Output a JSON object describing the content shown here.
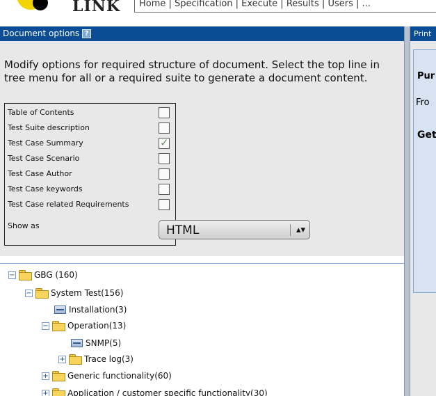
{
  "header": {
    "logo_text": "LINK",
    "nav_items": [
      "Home",
      "Specification",
      "Execute",
      "Results",
      "Users",
      "..."
    ]
  },
  "document_options": {
    "title": "Document options",
    "help_icon": "?",
    "instructions": "Modify options for required structure of document. Select the top line in tree menu for all or a required suite to generate a document content.",
    "options": [
      {
        "label": "Table of Contents",
        "checked": false
      },
      {
        "label": "Test Suite description",
        "checked": false
      },
      {
        "label": "Test Case Summary",
        "checked": true
      },
      {
        "label": "Test Case Scenario",
        "checked": false
      },
      {
        "label": "Test Case Author",
        "checked": false
      },
      {
        "label": "Test Case keywords",
        "checked": false
      },
      {
        "label": "Test Case related Requirements",
        "checked": false
      }
    ],
    "show_as": {
      "label": "Show as",
      "value": "HTML"
    }
  },
  "tree": {
    "nodes": [
      {
        "label": "GBG (160)",
        "type": "folder",
        "toggle": "−"
      },
      {
        "label": "System Test(156)",
        "type": "folder",
        "toggle": "−"
      },
      {
        "label": "Installation(3)",
        "type": "suite",
        "toggle": ""
      },
      {
        "label": "Operation(13)",
        "type": "folder",
        "toggle": "−"
      },
      {
        "label": "SNMP(5)",
        "type": "suite",
        "toggle": ""
      },
      {
        "label": "Trace log(3)",
        "type": "folder",
        "toggle": "+"
      },
      {
        "label": "Generic functionality(60)",
        "type": "folder",
        "toggle": "+"
      },
      {
        "label": "Application / customer specific functionality(30)",
        "type": "folder",
        "toggle": "+"
      }
    ]
  },
  "print_panel": {
    "title": "Print",
    "purpose_fragment": "Pur",
    "from_fragment": "Fro",
    "get_fragment": "Get"
  },
  "colors": {
    "titlebar": "#0b4d94",
    "panel_bg": "#e8e8e8",
    "tree_border": "#7ea6d4"
  }
}
